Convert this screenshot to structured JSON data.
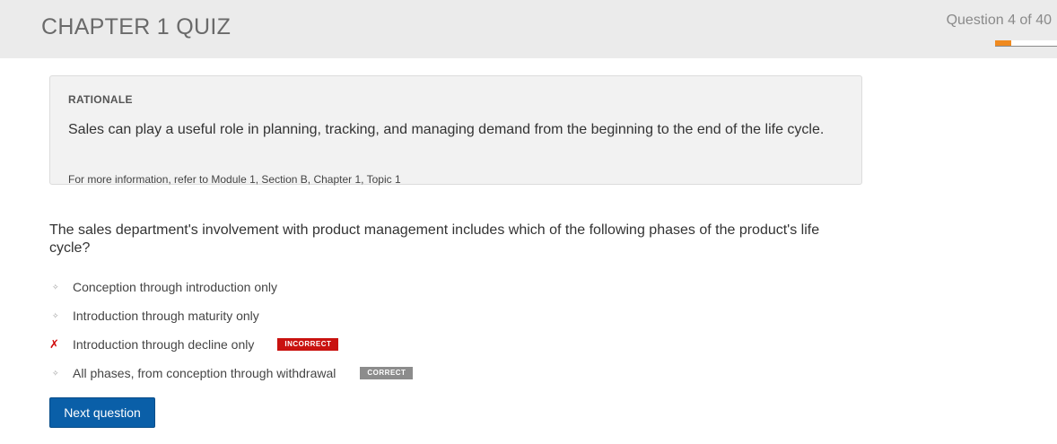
{
  "header": {
    "title": "CHAPTER 1 QUIZ",
    "counter": "Question 4 of 40",
    "progress": {
      "current": 4,
      "total": 40,
      "fraction": 0.26
    }
  },
  "rationale": {
    "label": "RATIONALE",
    "text": "Sales can play a useful role in planning, tracking, and managing demand from the beginning to the end of the life cycle.",
    "reference": "For more information, refer to Module 1, Section B, Chapter 1, Topic 1"
  },
  "question": {
    "text": "The sales department's involvement with product management includes which of the following phases of the product's life cycle?"
  },
  "answers": [
    {
      "marker": "✧",
      "text": "Conception through introduction only",
      "badge": ""
    },
    {
      "marker": "✧",
      "text": "Introduction through maturity only",
      "badge": ""
    },
    {
      "marker": "✗",
      "text": "Introduction through decline only",
      "badge": "INCORRECT"
    },
    {
      "marker": "✧",
      "text": "All phases, from conception through withdrawal",
      "badge": "CORRECT"
    }
  ],
  "actions": {
    "next_label": "Next question"
  },
  "colors": {
    "accent_progress": "#f08a1f",
    "incorrect": "#c9120f",
    "correct": "#8c8c8c",
    "button": "#0a5fa8"
  }
}
